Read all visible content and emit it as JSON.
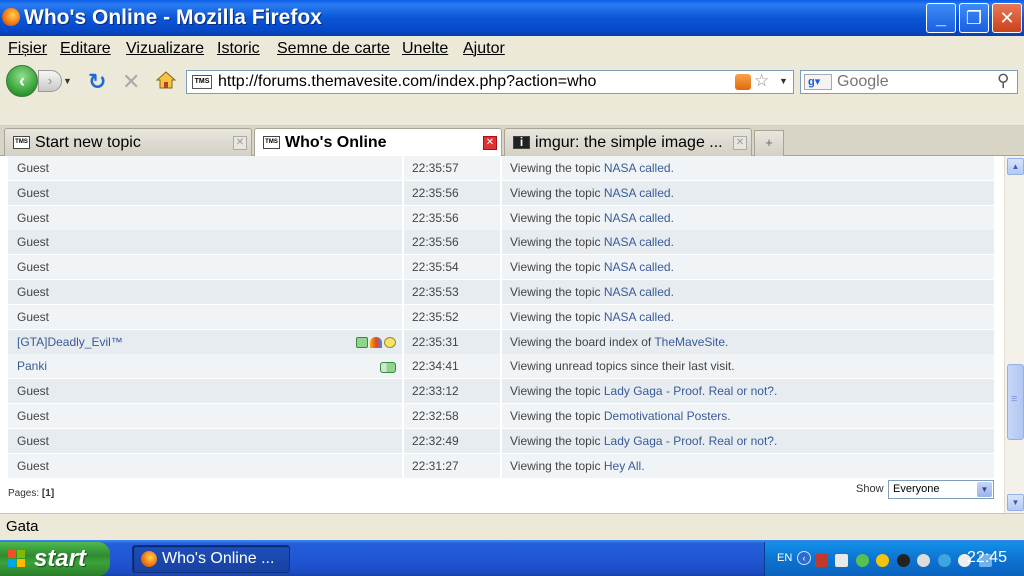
{
  "window": {
    "title": "Who's Online - Mozilla Firefox"
  },
  "menu": [
    "Fișier",
    "Editare",
    "Vizualizare",
    "Istoric",
    "Semne de carte",
    "Unelte",
    "Ajutor"
  ],
  "nav": {
    "url": "http://forums.themavesite.com/index.php?action=who",
    "site_icon_text": "TMS",
    "search_placeholder": "Google"
  },
  "tabs": [
    {
      "label": "Start new topic",
      "icon": "TMS",
      "active": false
    },
    {
      "label": "Who's Online",
      "icon": "TMS",
      "active": true
    },
    {
      "label": "imgur: the simple image ...",
      "icon": "i",
      "active": false
    }
  ],
  "online_rows": [
    {
      "name": "Guest",
      "time": "22:35:57",
      "action_prefix": "Viewing the topic",
      "action_link": "NASA called.",
      "member": false,
      "icons": []
    },
    {
      "name": "Guest",
      "time": "22:35:56",
      "action_prefix": "Viewing the topic",
      "action_link": "NASA called.",
      "member": false,
      "icons": []
    },
    {
      "name": "Guest",
      "time": "22:35:56",
      "action_prefix": "Viewing the topic",
      "action_link": "NASA called.",
      "member": false,
      "icons": []
    },
    {
      "name": "Guest",
      "time": "22:35:56",
      "action_prefix": "Viewing the topic",
      "action_link": "NASA called.",
      "member": false,
      "icons": []
    },
    {
      "name": "Guest",
      "time": "22:35:54",
      "action_prefix": "Viewing the topic",
      "action_link": "NASA called.",
      "member": false,
      "icons": []
    },
    {
      "name": "Guest",
      "time": "22:35:53",
      "action_prefix": "Viewing the topic",
      "action_link": "NASA called.",
      "member": false,
      "icons": []
    },
    {
      "name": "Guest",
      "time": "22:35:52",
      "action_prefix": "Viewing the topic",
      "action_link": "NASA called.",
      "member": false,
      "icons": []
    },
    {
      "name": "[GTA]Deadly_Evil™",
      "time": "22:35:31",
      "action_prefix": "Viewing the board index of",
      "action_link": "TheMaveSite.",
      "member": true,
      "icons": [
        "pm-icon",
        "msn-icon",
        "smiley-icon"
      ]
    },
    {
      "name": "Panki",
      "time": "22:34:41",
      "action_prefix": "Viewing unread topics since their last visit.",
      "action_link": "",
      "member": true,
      "icons": [
        "pm-icon"
      ]
    },
    {
      "name": "Guest",
      "time": "22:33:12",
      "action_prefix": "Viewing the topic",
      "action_link": "Lady Gaga - Proof. Real or not?.",
      "member": false,
      "icons": []
    },
    {
      "name": "Guest",
      "time": "22:32:58",
      "action_prefix": "Viewing the topic",
      "action_link": "Demotivational Posters.",
      "member": false,
      "icons": []
    },
    {
      "name": "Guest",
      "time": "22:32:49",
      "action_prefix": "Viewing the topic",
      "action_link": "Lady Gaga - Proof. Real or not?.",
      "member": false,
      "icons": []
    },
    {
      "name": "Guest",
      "time": "22:31:27",
      "action_prefix": "Viewing the topic",
      "action_link": "Hey All.",
      "member": false,
      "icons": []
    }
  ],
  "pages": {
    "label": "Pages:",
    "current": "[1]"
  },
  "show": {
    "label": "Show",
    "value": "Everyone"
  },
  "status": {
    "text": "Gata"
  },
  "taskbar": {
    "start": "start",
    "task_label": "Who's Online ...",
    "lang": "EN",
    "clock": "22:45"
  }
}
